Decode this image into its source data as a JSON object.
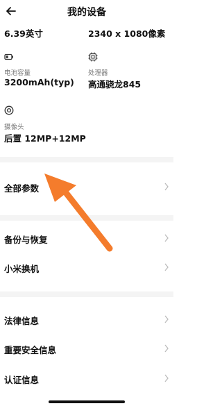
{
  "header": {
    "title": "我的设备"
  },
  "specs": {
    "screen_size": "6.39英寸",
    "resolution": "2340 x 1080像素",
    "battery": {
      "icon": "battery-icon",
      "label": "电池容量",
      "value": "3200mAh(typ)"
    },
    "processor": {
      "icon": "chip-icon",
      "label": "处理器",
      "value": "高通骁龙845"
    },
    "camera": {
      "icon": "camera-icon",
      "label": "摄像头",
      "value": "后置 12MP+12MP"
    }
  },
  "menu": {
    "all_params": "全部参数",
    "backup_restore": "备份与恢复",
    "mi_mover": "小米换机",
    "legal_info": "法律信息",
    "safety_info": "重要安全信息",
    "certification_info": "认证信息"
  },
  "annotation": {
    "color": "#f47c2c"
  }
}
